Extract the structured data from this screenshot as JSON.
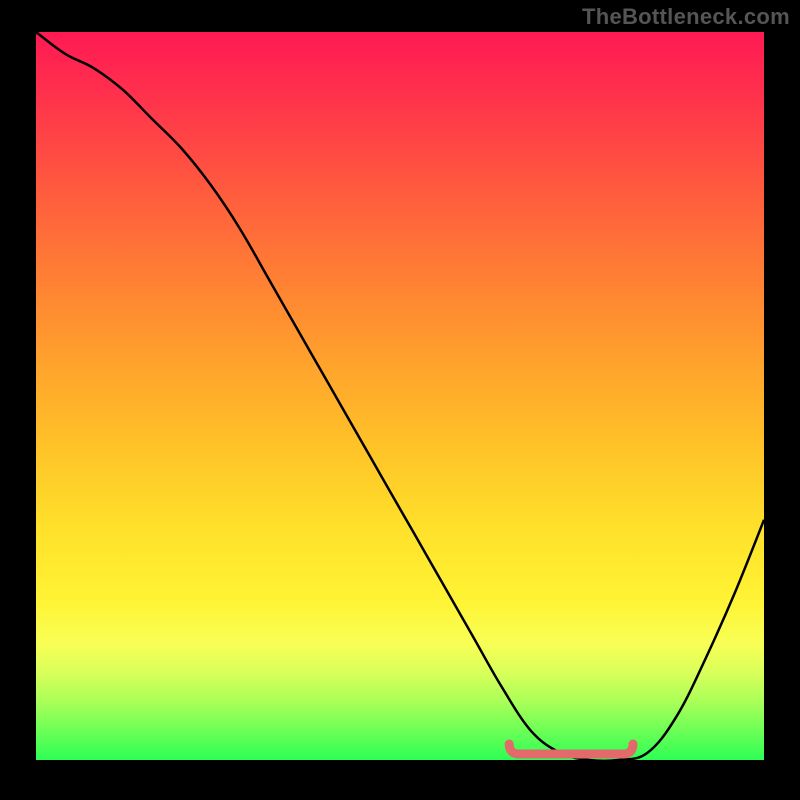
{
  "watermark": "TheBottleneck.com",
  "chart_data": {
    "type": "line",
    "title": "",
    "xlabel": "",
    "ylabel": "",
    "xlim": [
      0,
      100
    ],
    "ylim": [
      0,
      100
    ],
    "series": [
      {
        "name": "bottleneck-curve",
        "x": [
          0,
          4,
          8,
          12,
          16,
          20,
          24,
          28,
          32,
          36,
          40,
          44,
          48,
          52,
          56,
          60,
          64,
          68,
          72,
          76,
          80,
          84,
          88,
          92,
          96,
          100
        ],
        "values": [
          100,
          97,
          95,
          92,
          88,
          84,
          79,
          73,
          66,
          59,
          52,
          45,
          38,
          31,
          24,
          17,
          10,
          4,
          1,
          0,
          0,
          1,
          6,
          14,
          23,
          33
        ]
      },
      {
        "name": "optimal-range-marker",
        "x_start": 65,
        "x_end": 82,
        "value": 0
      }
    ],
    "gradient_stops": [
      {
        "pos": 0,
        "color": "#ff1a53"
      },
      {
        "pos": 8,
        "color": "#ff2f4d"
      },
      {
        "pos": 20,
        "color": "#ff5540"
      },
      {
        "pos": 32,
        "color": "#ff7a35"
      },
      {
        "pos": 44,
        "color": "#ff9e2d"
      },
      {
        "pos": 56,
        "color": "#ffc028"
      },
      {
        "pos": 68,
        "color": "#ffe02a"
      },
      {
        "pos": 78,
        "color": "#fff334"
      },
      {
        "pos": 84,
        "color": "#f8ff55"
      },
      {
        "pos": 88,
        "color": "#d9ff5a"
      },
      {
        "pos": 92,
        "color": "#a9ff58"
      },
      {
        "pos": 96,
        "color": "#6cff56"
      },
      {
        "pos": 100,
        "color": "#2dff55"
      }
    ]
  }
}
